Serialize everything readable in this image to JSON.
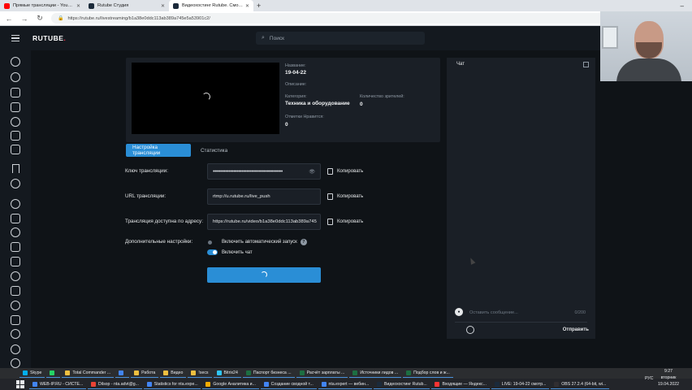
{
  "browser": {
    "tabs": [
      {
        "label": "Прямые трансляции - YouTube",
        "icon": "youtube-icon",
        "color": "#ff0000"
      },
      {
        "label": "Rutube Студия",
        "icon": "rutube-icon",
        "color": "#1b2a3a"
      },
      {
        "label": "Видеохостинг Rutube. Смотрит",
        "icon": "rutube-icon",
        "color": "#1b2a3a",
        "active": true
      }
    ],
    "url": "https://rutube.ru/livestreaming/b1a38e0ddc113ab389a745e5a53901c2/"
  },
  "header": {
    "logo": "RUTUBE",
    "search_placeholder": "Поиск"
  },
  "video_info": {
    "name_label": "Название:",
    "name_value": "19-04-22",
    "description_label": "Описание:",
    "category_label": "Категория:",
    "category_value": "Техника и оборудование",
    "viewers_label": "Количество зрителей:",
    "viewers_value": "0",
    "likes_label": "Отметки Нравится:",
    "likes_value": "0"
  },
  "tabs": {
    "settings": "Настройка трансляции",
    "stats": "Статистика"
  },
  "form": {
    "stream_key_label": "Ключ трансляции:",
    "stream_key_value": "••••••••••••••••••••••••••••••••••••••••••••",
    "url_label": "URL трансляции:",
    "url_value": "rtmp://u.rutube.ru/live_push",
    "address_label": "Трансляция доступна по адресу:",
    "address_value": "https://rutube.ru/video/b1a38e0ddc113ab389a745",
    "copy_label": "Копировать",
    "extra_label": "Дополнительные настройки:",
    "autostart_label": "Включить автоматический запуск",
    "chat_toggle_label": "Включить чат"
  },
  "chat": {
    "title": "Чат",
    "input_placeholder": "Оставить сообщение...",
    "counter": "0/200",
    "send_label": "Отправить"
  },
  "taskbar": {
    "row1": [
      {
        "label": "Skype",
        "color": "#00aff0"
      },
      {
        "label": "",
        "color": "#25d366"
      },
      {
        "label": "Total Commander ...",
        "color": "#f0c040"
      },
      {
        "label": "",
        "color": "#4285f4"
      },
      {
        "label": "Работа",
        "color": "#f0c040"
      },
      {
        "label": "Видео",
        "color": "#f0c040"
      },
      {
        "label": "!secs",
        "color": "#f0c040"
      },
      {
        "label": "Bitrix24",
        "color": "#2fc6f6"
      },
      {
        "label": "Паспорт бизнеса ...",
        "color": "#1d6f42"
      },
      {
        "label": "Расчёт зарплаты ...",
        "color": "#1d6f42"
      },
      {
        "label": "Источники лидов ...",
        "color": "#1d6f42"
      },
      {
        "label": "Подбор слов и ж...",
        "color": "#1d6f42"
      }
    ],
    "row2": [
      {
        "label": "WEB-IP.RU - СИСТЕ...",
        "color": "#4285f4"
      },
      {
        "label": "Dilsop - nta.advt@g...",
        "color": "#ea4335"
      },
      {
        "label": "Statistics for nta.expe...",
        "color": "#4285f4"
      },
      {
        "label": "Google Аналитика и...",
        "color": "#f9ab00"
      },
      {
        "label": "Создание сводной т...",
        "color": "#4285f4"
      },
      {
        "label": "nta.expert — вебин...",
        "color": "#4285f4"
      },
      {
        "label": "Видеохостинг Rutub...",
        "color": "#1b2a3a"
      },
      {
        "label": "Входящие — Яндекс...",
        "color": "#ff3333"
      },
      {
        "label": "LIVE: 19-04-22 смотр...",
        "color": "#1b2a3a"
      },
      {
        "label": "OBS 27.2.4 (64-bit, wi...",
        "color": "#302e31"
      }
    ],
    "lang": "РУС",
    "time": "9:27",
    "weekday": "вторник",
    "date": "19.04.2022"
  }
}
